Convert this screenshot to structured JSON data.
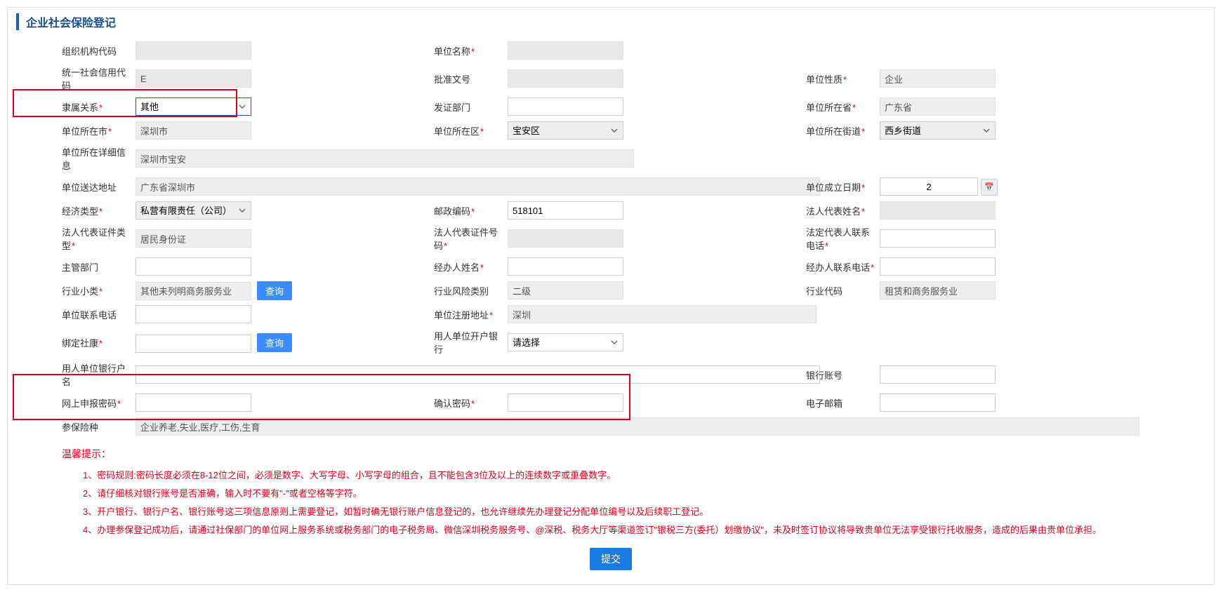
{
  "page": {
    "title": "企业社会保险登记"
  },
  "labels": {
    "org_code": "组织机构代码",
    "unit_name": "单位名称",
    "usc_code": "统一社会信用代码",
    "approval_no": "批准文号",
    "unit_nature": "单位性质",
    "affiliation": "隶属关系",
    "issue_dept": "发证部门",
    "province": "单位所在省",
    "city": "单位所在市",
    "district": "单位所在区",
    "street": "单位所在街道",
    "detail_addr": "单位所在详细信息",
    "delivery_addr": "单位送达地址",
    "est_date": "单位成立日期",
    "econ_type": "经济类型",
    "postal": "邮政编码",
    "legal_name": "法人代表姓名",
    "legal_id_type": "法人代表证件类型",
    "legal_id_no": "法人代表证件号码",
    "legal_phone": "法定代表人联系电话",
    "supervisor": "主管部门",
    "handler_name": "经办人姓名",
    "handler_phone": "经办人联系电话",
    "industry_sub": "行业小类",
    "risk_level": "行业风险类别",
    "industry_code": "行业代码",
    "unit_phone": "单位联系电话",
    "reg_addr": "单位注册地址",
    "bind_shekang": "绑定社康",
    "bank": "用人单位开户银行",
    "bank_acct_name": "用人单位银行户名",
    "bank_acct_no": "银行账号",
    "online_pwd": "网上申报密码",
    "confirm_pwd": "确认密码",
    "email": "电子邮箱",
    "ins_types": "参保险种"
  },
  "values": {
    "org_code": " ",
    "unit_name": " ",
    "usc_code": "                                E",
    "approval_no": " ",
    "unit_nature": "企业",
    "affiliation": "其他",
    "province": "广东省",
    "city": "深圳市",
    "district": "宝安区",
    "street": "西乡街道",
    "detail_addr": "深圳市宝安",
    "delivery_addr": "广东省深圳市",
    "est_date": "2",
    "econ_type": "私营有限责任（公司）",
    "postal": "518101",
    "legal_name": " ",
    "legal_id_type": "居民身份证",
    "legal_id_no": " ",
    "industry_sub": "其他未列明商务服务业",
    "risk_level": "二级",
    "industry_code": "租赁和商务服务业",
    "reg_addr": "深圳",
    "bank": "请选择",
    "ins_types": "企业养老,失业,医疗,工伤,生育"
  },
  "buttons": {
    "query": "查询",
    "submit": "提交"
  },
  "tips": {
    "title": "温馨提示：",
    "items": [
      "1、密码规则:密码长度必须在8-12位之间，必须是数字、大写字母、小写字母的组合，且不能包含3位及以上的连续数字或重叠数字。",
      "2、请仔细核对银行账号是否准确，输入时不要有\"-\"或者空格等字符。",
      "3、开户银行、银行户名、银行账号这三项信息原则上需要登记，如暂时确无银行账户信息登记的，也允许继续先办理登记分配单位编号以及后续职工登记。",
      "4、办理参保登记成功后，请通过社保部门的单位网上服务系统或税务部门的电子税务局、微信深圳税务服务号、@深税、税务大厅等渠道签订\"银税三方(委托）划缴协议\"，未及时签订协议将导致贵单位无法享受银行托收服务，造成的后果由贵单位承担。"
    ]
  }
}
